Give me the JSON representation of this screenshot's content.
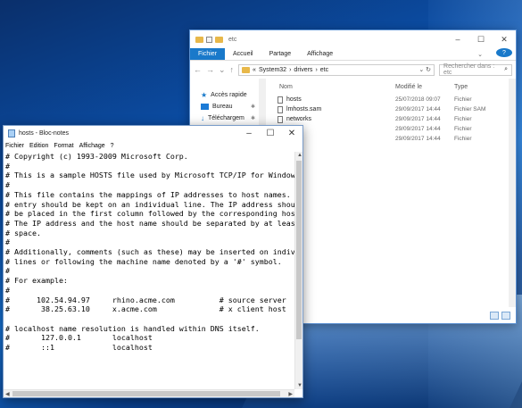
{
  "explorer": {
    "title": "etc",
    "tabs": [
      "Fichier",
      "Accueil",
      "Partage",
      "Affichage"
    ],
    "help_label": "?",
    "breadcrumb": [
      "«",
      "System32",
      "›",
      "drivers",
      "›",
      "etc"
    ],
    "search_placeholder": "Rechercher dans : etc",
    "nav": [
      {
        "label": "Accès rapide"
      },
      {
        "label": "Bureau"
      },
      {
        "label": "Téléchargem"
      }
    ],
    "columns": {
      "name": "Nom",
      "date": "Modifié le",
      "type": "Type"
    },
    "files": [
      {
        "name": "hosts",
        "date": "25/07/2018 09:07",
        "type": "Fichier"
      },
      {
        "name": "lmhosts.sam",
        "date": "29/09/2017 14:44",
        "type": "Fichier SAM"
      },
      {
        "name": "networks",
        "date": "29/09/2017 14:44",
        "type": "Fichier"
      },
      {
        "name": "ol",
        "date": "29/09/2017 14:44",
        "type": "Fichier"
      },
      {
        "name": "s",
        "date": "29/09/2017 14:44",
        "type": "Fichier"
      }
    ]
  },
  "notepad": {
    "title": "hosts - Bloc-notes",
    "menu": [
      "Fichier",
      "Edition",
      "Format",
      "Affichage",
      "?"
    ],
    "content": "# Copyright (c) 1993-2009 Microsoft Corp.\n#\n# This is a sample HOSTS file used by Microsoft TCP/IP for Windows.\n#\n# This file contains the mappings of IP addresses to host names. Each\n# entry should be kept on an individual line. The IP address should\n# be placed in the first column followed by the corresponding host nam\n# The IP address and the host name should be separated by at least one\n# space.\n#\n# Additionally, comments (such as these) may be inserted on individual\n# lines or following the machine name denoted by a '#' symbol.\n#\n# For example:\n#\n#      102.54.94.97     rhino.acme.com          # source server\n#       38.25.63.10     x.acme.com              # x client host\n\n# localhost name resolution is handled within DNS itself.\n#\t127.0.0.1       localhost\n#\t::1             localhost"
  }
}
